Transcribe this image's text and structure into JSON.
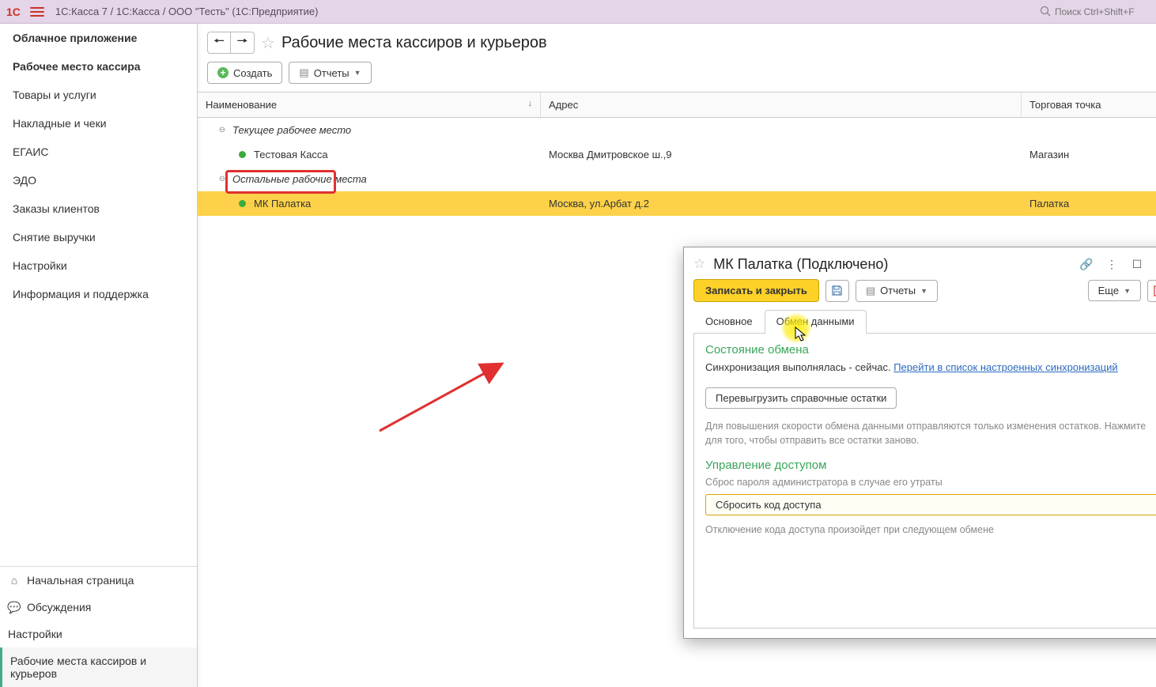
{
  "titlebar": {
    "text": "1С:Касса 7 / 1С:Касса / ООО \"Тесть\"  (1С:Предприятие)",
    "search_placeholder": "Поиск Ctrl+Shift+F"
  },
  "sidebar": {
    "top": [
      {
        "label": "Облачное приложение",
        "bold": true
      },
      {
        "label": "Рабочее место кассира",
        "bold": true
      },
      {
        "label": "Товары и услуги",
        "bold": false
      },
      {
        "label": "Накладные и чеки",
        "bold": false
      },
      {
        "label": "ЕГАИС",
        "bold": false
      },
      {
        "label": "ЭДО",
        "bold": false
      },
      {
        "label": "Заказы клиентов",
        "bold": false
      },
      {
        "label": "Снятие выручки",
        "bold": false
      },
      {
        "label": "Настройки",
        "bold": false
      },
      {
        "label": "Информация и поддержка",
        "bold": false
      }
    ],
    "bottom": [
      {
        "label": "Начальная страница",
        "icon": "home"
      },
      {
        "label": "Обсуждения",
        "icon": "chat"
      },
      {
        "label": "Настройки",
        "icon": ""
      },
      {
        "label": "Рабочие места кассиров и курьеров",
        "icon": "",
        "active": true
      }
    ]
  },
  "page": {
    "title": "Рабочие места кассиров и курьеров",
    "create_btn": "Создать",
    "reports_btn": "Отчеты"
  },
  "table": {
    "cols": {
      "name": "Наименование",
      "addr": "Адрес",
      "tp": "Торговая точка"
    },
    "group1": "Текущее рабочее место",
    "row1": {
      "name": "Тестовая Касса",
      "addr": "Москва Дмитровское ш.,9",
      "tp": "Магазин"
    },
    "group2": "Остальные рабочие места",
    "row2": {
      "name": "МК Палатка",
      "addr": "Москва, ул.Арбат д.2",
      "tp": "Палатка"
    }
  },
  "dialog": {
    "title": "МК Палатка (Подключено)",
    "save_close": "Записать и закрыть",
    "reports": "Отчеты",
    "more": "Еще",
    "tab1": "Основное",
    "tab2": "Обмен данными",
    "section1": "Состояние обмена",
    "sync_text": "Синхронизация выполнялась - сейчас.",
    "sync_link": "Перейти в список настроенных синхронизаций",
    "reload_btn": "Перевыгрузить справочные остатки",
    "hint1": "Для повышения скорости обмена данными отправляются только изменения остатков. Нажмите для того, чтобы отправить все остатки заново.",
    "section2": "Управление доступом",
    "access_text": "Сброс пароля администратора в случае его утраты",
    "reset_btn": "Сбросить код доступа",
    "hint2": "Отключение кода доступа произойдет при следующем обмене"
  }
}
